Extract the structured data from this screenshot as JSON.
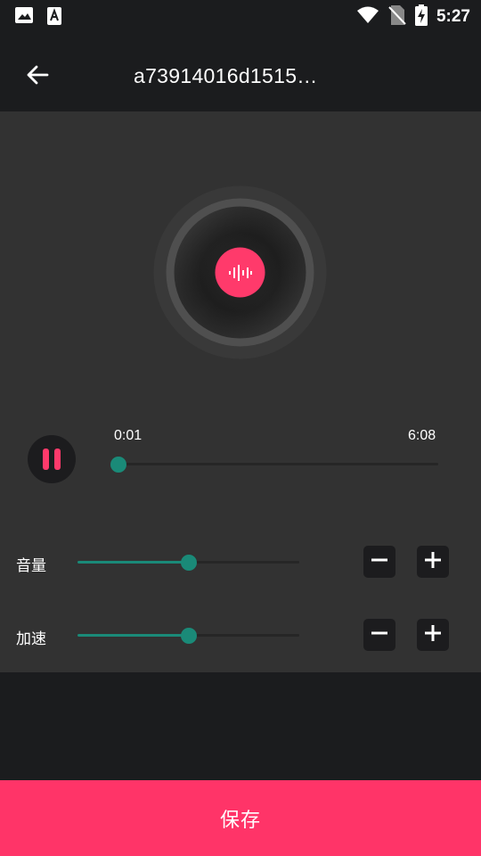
{
  "status_bar": {
    "time": "5:27",
    "left_icons": [
      "image-icon",
      "text-a-icon"
    ],
    "right_icons": [
      "wifi-icon",
      "no-sim-icon",
      "battery-charging-icon"
    ]
  },
  "app_bar": {
    "back_icon": "arrow-left-icon",
    "title": "a73914016d1515…"
  },
  "player": {
    "disc_icon": "audio-wave-icon",
    "current_time": "0:01",
    "total_time": "6:08",
    "progress": 0.003,
    "accent_color": "#ff3a6b",
    "track_color": "#1a8a78"
  },
  "controls": [
    {
      "id": "volume",
      "label": "音量",
      "level": 0.5,
      "minus_icon": "minus-icon",
      "plus_icon": "plus-icon"
    },
    {
      "id": "speed",
      "label": "加速",
      "level": 0.5,
      "minus_icon": "minus-icon",
      "plus_icon": "plus-icon"
    }
  ],
  "footer": {
    "save_label": "保存",
    "color": "#ff3468"
  }
}
